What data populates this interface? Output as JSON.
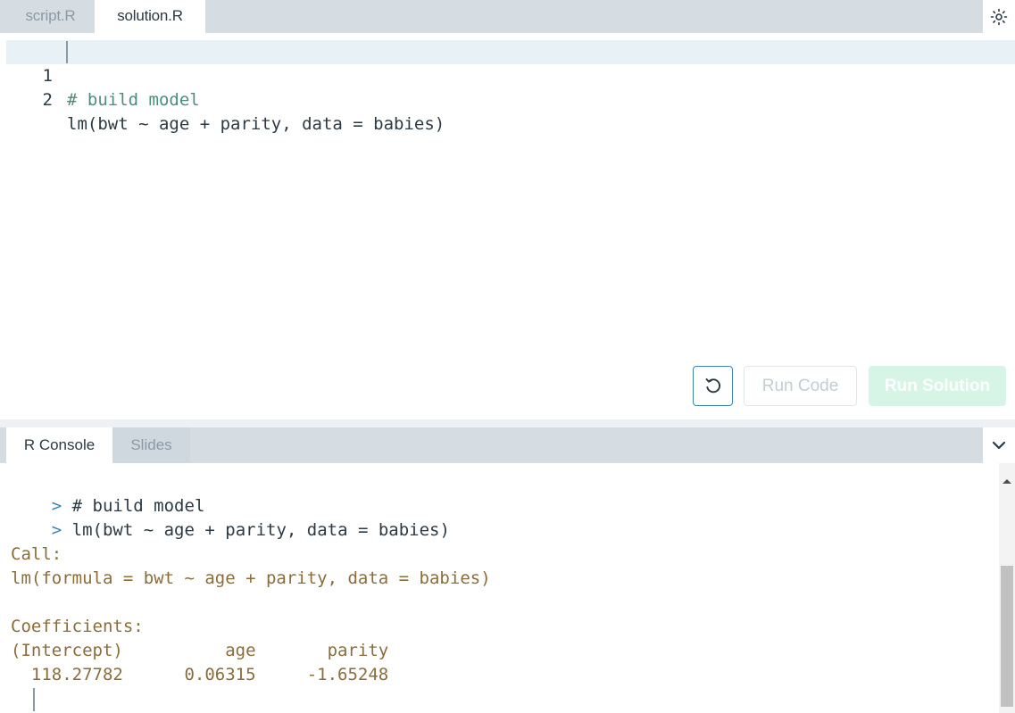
{
  "editor_tabs": [
    {
      "label": "script.R",
      "active": false
    },
    {
      "label": "solution.R",
      "active": true
    }
  ],
  "editor": {
    "lines": [
      {
        "number": "1",
        "text": "# build model"
      },
      {
        "number": "2",
        "text": "lm(bwt ~ age + parity, data = babies)"
      }
    ]
  },
  "buttons": {
    "run_code": "Run Code",
    "run_solution": "Run Solution"
  },
  "console_tabs": [
    {
      "label": "R Console",
      "active": true
    },
    {
      "label": "Slides",
      "active": false
    }
  ],
  "console": {
    "prompt": ">",
    "commands": [
      "# build model",
      "lm(bwt ~ age + parity, data = babies)"
    ],
    "output": {
      "call_label": "Call:",
      "call_text": "lm(formula = bwt ~ age + parity, data = babies)",
      "coef_label": "Coefficients:",
      "coef_header": "(Intercept)          age       parity  ",
      "coef_values": "  118.27782      0.06315     -1.65248  "
    }
  },
  "icons": {
    "settings": "gear-icon",
    "reset": "reset-icon",
    "collapse": "chevron-down-icon"
  },
  "colors": {
    "tabbar_bg": "#d5dde3",
    "comment": "#4f8c80",
    "console_output": "#8a6d3b",
    "active_line": "#e8f2f6",
    "accent": "#3b85b4"
  }
}
